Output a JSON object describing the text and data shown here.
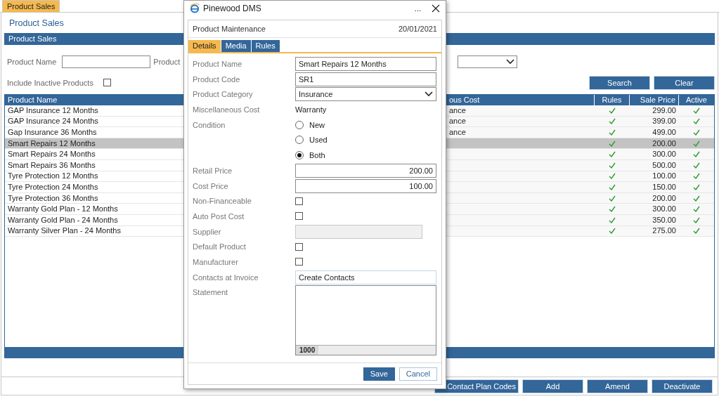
{
  "top_tab": {
    "label": "Product Sales",
    "selected": true
  },
  "page_link": "Product Sales",
  "section_header": "Product Sales",
  "filters": {
    "product_name_label": "Product Name",
    "product_label": "Product",
    "include_inactive_label": "Include Inactive Products",
    "include_inactive_checked": false
  },
  "filter_buttons": [
    "Search",
    "Clear"
  ],
  "table": {
    "columns": [
      "Product Name",
      "ous Cost",
      "Rules",
      "Sale Price",
      "Active"
    ],
    "rows": [
      {
        "product_name": "GAP Insurance 12 Months",
        "column_2": "ance",
        "rules": true,
        "sale_price": "299.00",
        "active": true,
        "selected": false
      },
      {
        "product_name": "GAP Insurance 24 Months",
        "column_2": "ance",
        "rules": true,
        "sale_price": "399.00",
        "active": true,
        "selected": false
      },
      {
        "product_name": "Gap Insurance 36 Months",
        "column_2": "ance",
        "rules": true,
        "sale_price": "499.00",
        "active": true,
        "selected": false
      },
      {
        "product_name": "Smart Repairs 12 Months",
        "rules": true,
        "sale_price": "200.00",
        "active": true,
        "selected": true
      },
      {
        "product_name": "Smart Repairs 24 Months",
        "rules": true,
        "sale_price": "300.00",
        "active": true,
        "selected": false
      },
      {
        "product_name": "Smart Repairs 36 Months",
        "rules": true,
        "sale_price": "500.00",
        "active": true,
        "selected": false
      },
      {
        "product_name": "Tyre Protection 12 Months",
        "rules": true,
        "sale_price": "100.00",
        "active": true,
        "selected": false
      },
      {
        "product_name": "Tyre Protection 24 Months",
        "rules": true,
        "sale_price": "150.00",
        "active": true,
        "selected": false
      },
      {
        "product_name": "Tyre Protection 36 Months",
        "rules": true,
        "sale_price": "200.00",
        "active": true,
        "selected": false
      },
      {
        "product_name": "Warranty Gold Plan - 12 Months",
        "rules": true,
        "sale_price": "300.00",
        "active": true,
        "selected": false
      },
      {
        "product_name": "Warranty Gold Plan - 24 Months",
        "rules": true,
        "sale_price": "350.00",
        "active": true,
        "selected": false
      },
      {
        "product_name": "Warranty Silver Plan - 24 Months",
        "rules": true,
        "sale_price": "275.00",
        "active": true,
        "selected": false
      }
    ]
  },
  "footer_buttons": [
    "Contact Plan Codes",
    "Add",
    "Amend",
    "Deactivate"
  ],
  "dialog": {
    "title": "Pinewood DMS",
    "menu": "...",
    "heading": "Product Maintenance",
    "date": "20/01/2021",
    "tabs": [
      {
        "label": "Details",
        "selected": true
      },
      {
        "label": "Media",
        "selected": false
      },
      {
        "label": "Rules",
        "selected": false
      }
    ],
    "form": [
      {
        "kind": "text",
        "label": "Product Name",
        "value": "Smart Repairs 12 Months"
      },
      {
        "kind": "text",
        "label": "Product Code",
        "value": "SR1"
      },
      {
        "kind": "select",
        "label": "Product Category",
        "value": "Insurance"
      },
      {
        "kind": "static",
        "label": "Miscellaneous Cost",
        "value": "Warranty"
      },
      {
        "kind": "radio",
        "label": "Condition",
        "options": [
          {
            "label": "New",
            "selected": false
          },
          {
            "label": "Used",
            "selected": false
          },
          {
            "label": "Both",
            "selected": true
          }
        ]
      },
      {
        "kind": "number",
        "label": "Retail Price",
        "value": "200.00"
      },
      {
        "kind": "number",
        "label": "Cost Price",
        "value": "100.00"
      },
      {
        "kind": "checkbox",
        "label": "Non-Financeable",
        "checked": false
      },
      {
        "kind": "checkbox",
        "label": "Auto Post Cost",
        "checked": false
      },
      {
        "kind": "disabled",
        "label": "Supplier"
      },
      {
        "kind": "checkbox",
        "label": "Default Product",
        "checked": false
      },
      {
        "kind": "checkbox",
        "label": "Manufacturer",
        "checked": false
      },
      {
        "kind": "light",
        "label": "Contacts at Invoice",
        "value": "Create Contacts"
      },
      {
        "kind": "textarea",
        "label": "Statement",
        "counter": "1000"
      }
    ],
    "buttons": [
      "Save",
      "Cancel"
    ]
  }
}
